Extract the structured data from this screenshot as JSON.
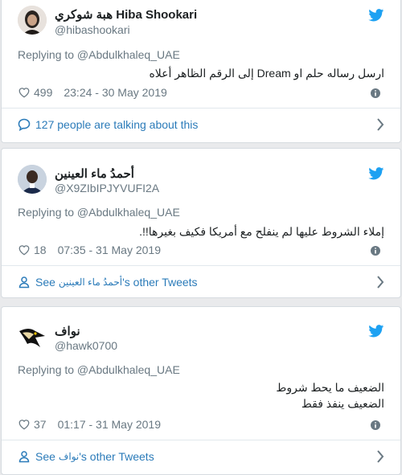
{
  "tweets": [
    {
      "name": "Hiba Shookari",
      "name_ar": "هبة شوكري",
      "handle": "@hibashookari",
      "replying": "Replying to @Abdulkhaleq_UAE",
      "text_lines": [
        "ارسل رساله حلم او Dream إلى الرقم الظاهر أعلاه"
      ],
      "likes": "499",
      "time": "23:24 - 30 May 2019",
      "footer": "127 people are talking about this"
    },
    {
      "name": "أحمدُ ماء العينين",
      "handle": "@X9ZIbIPJYVUFI2A",
      "replying": "Replying to @Abdulkhaleq_UAE",
      "text_lines": [
        "إملاء الشروط عليها لم ينفلح مع أمريكا فكيف بغيرها!!."
      ],
      "likes": "18",
      "time": "07:35 - 31 May 2019",
      "footer_see": "See",
      "footer_name": "أحمدُ ماء العينين",
      "footer_suffix": "'s other Tweets"
    },
    {
      "name": "نواف",
      "handle": "@hawk0700",
      "replying": "Replying to @Abdulkhaleq_UAE",
      "text_lines": [
        "الضعيف ما يحط شروط",
        "الضعيف ينفذ فقط"
      ],
      "likes": "37",
      "time": "01:17 - 31 May 2019",
      "footer_see": "See",
      "footer_name": "نواف",
      "footer_suffix": "'s other Tweets"
    }
  ],
  "colors": {
    "link": "#2b7bb9",
    "muted": "#697882",
    "twitter": "#1da1f2"
  }
}
